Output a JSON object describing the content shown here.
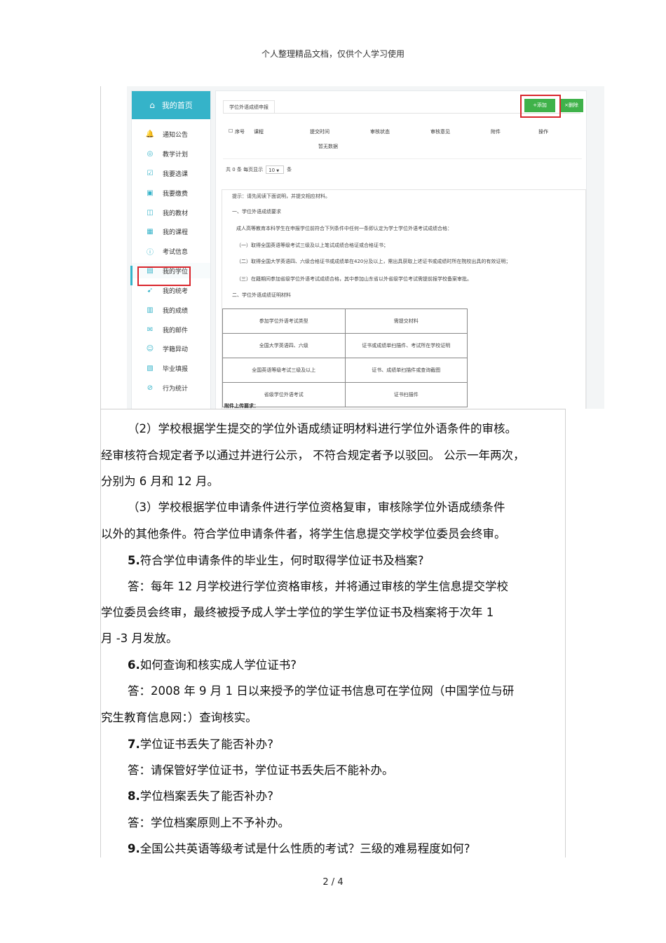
{
  "header_note": "个人整理精品文档，仅供个人学习使用",
  "sidebar": {
    "home": "我的首页",
    "items": [
      {
        "label": "通知公告",
        "icon": "bell-icon",
        "glyph": "🔔"
      },
      {
        "label": "教学计划",
        "icon": "chart-icon",
        "glyph": "◎"
      },
      {
        "label": "我要选课",
        "icon": "checkbox-icon",
        "glyph": "☑"
      },
      {
        "label": "我要缴费",
        "icon": "payment-icon",
        "glyph": "▣"
      },
      {
        "label": "我的教材",
        "icon": "book-icon",
        "glyph": "◫"
      },
      {
        "label": "我的课程",
        "icon": "grid-icon",
        "glyph": "▦"
      },
      {
        "label": "考试信息",
        "icon": "info-icon",
        "glyph": "ⓘ"
      },
      {
        "label": "我的学位",
        "icon": "degree-icon",
        "glyph": "▤"
      },
      {
        "label": "我的统考",
        "icon": "send-icon",
        "glyph": "➹"
      },
      {
        "label": "我的成绩",
        "icon": "score-icon",
        "glyph": "▥"
      },
      {
        "label": "我的邮件",
        "icon": "mail-icon",
        "glyph": "✉"
      },
      {
        "label": "学籍异动",
        "icon": "users-icon",
        "glyph": "☺"
      },
      {
        "label": "毕业填报",
        "icon": "form-icon",
        "glyph": "▧"
      },
      {
        "label": "行为统计",
        "icon": "stats-icon",
        "glyph": "⊘"
      }
    ]
  },
  "main": {
    "tab": "学位外语成绩申报",
    "add_button": "+添加",
    "delete_button": "×删除",
    "columns": [
      "序号",
      "课程",
      "提交时间",
      "审核状态",
      "审核意见",
      "附件",
      "操作"
    ],
    "empty_text": "暂无数据",
    "pager": {
      "prefix": "共 0 条 每页显示",
      "size": "10",
      "suffix": "条"
    },
    "tips": [
      "提示：请先阅读下面说明，并提交相应材料。",
      "一、学位外语成绩要求",
      "成人高等教育本科学生在申报学位前符合下列条件中任何一条即认定为学士学位外语考试成绩合格：",
      "（一）取得全国英语等级考试三级及以上笔试成绩合格证或合格证书；",
      "（二）取得全国大学英语四、六级合格证书或成绩单在420分及以上，需出具获取上述证书或成绩时所在院校出具的有效证明；",
      "（三）在籍期间参加省级学位外语考试成绩合格，其中参加山东省以外省级学位考试需提前报学校备案审批。",
      "二、学位外语成绩证明材料"
    ],
    "table": [
      [
        "参加学位外语考试类型",
        "需提交材料"
      ],
      [
        "全国大学英语四、六级",
        "证书或成绩单扫描件、考试所在学校证明"
      ],
      [
        "全国英语等级考试三级及以上",
        "证书、成绩单扫描件或查询截图"
      ],
      [
        "省级学位外语考试",
        "证书扫描件"
      ]
    ],
    "attach_note": "附件上传要求："
  },
  "paragraphs": [
    {
      "text": "（2）学校根据学生提交的学位外语成绩证明材料进行学位外语条件的审核。",
      "bold": ""
    },
    {
      "text": "经审核符合规定者予以通过并进行公示，    不符合规定者予以驳回。 公示一年两次，",
      "bold": ""
    },
    {
      "text": "分别为 6 月和 12 月。",
      "bold": ""
    },
    {
      "text": "（3）学校根据学位申请条件进行学位资格复审，审核除学位外语成绩条件",
      "bold": ""
    },
    {
      "text": "以外的其他条件。符合学位申请条件者，将学生信息提交学校学位委员会终审。",
      "bold": ""
    },
    {
      "text": "符合学位申请条件的毕业生，何时取得学位证书及档案?",
      "bold": "5."
    },
    {
      "text": "答：每年  12 月学校进行学位资格审核，并将通过审核的学生信息提交学校",
      "bold": ""
    },
    {
      "text": "学位委员会终审，最终被授予成人学士学位的学生学位证书及档案将于次年          1",
      "bold": ""
    },
    {
      "text": "月 -3 月发放。",
      "bold": ""
    },
    {
      "text": "如何查询和核实成人学位证书?",
      "bold": "6."
    },
    {
      "text": "答：2008 年 9 月 1 日以来授予的学位证书信息可在学位网（中国学位与研",
      "bold": ""
    },
    {
      "text": "究生教育信息网：）查询核实。",
      "bold": ""
    },
    {
      "text": "学位证书丢失了能否补办?",
      "bold": "7."
    },
    {
      "text": "答：请保管好学位证书，学位证书丢失后不能补办。",
      "bold": ""
    },
    {
      "text": "学位档案丢失了能否补办?",
      "bold": "8."
    },
    {
      "text": "答：学位档案原则上不予补办。",
      "bold": ""
    },
    {
      "text": "全国公共英语等级考试是什么性质的考试？三级的难易程度如何?",
      "bold": "9."
    }
  ],
  "page_number": "2 / 4",
  "colors": {
    "teal": "#35b3c9",
    "green": "#3fb24a",
    "red": "#d9252c"
  }
}
